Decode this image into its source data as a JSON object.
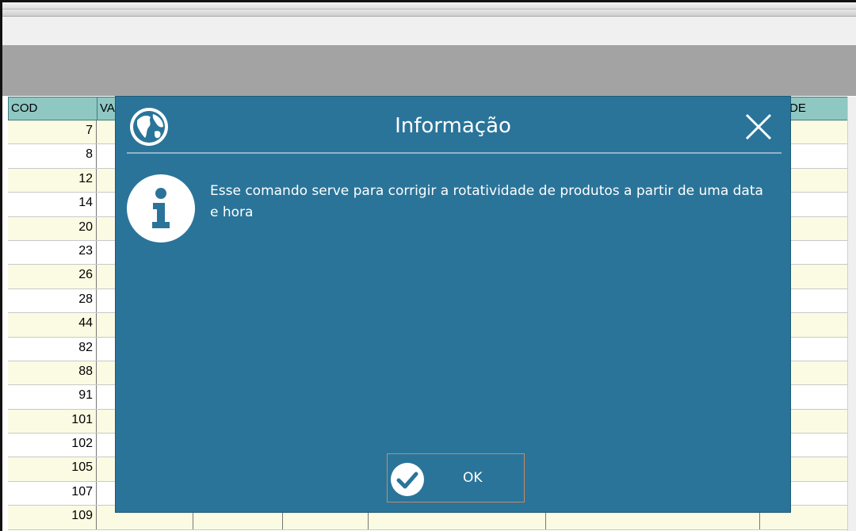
{
  "grid": {
    "columns": [
      "COD",
      "VA",
      "DE"
    ],
    "cod_values": [
      "7",
      "8",
      "12",
      "14",
      "20",
      "23",
      "26",
      "28",
      "44",
      "82",
      "88",
      "91",
      "101",
      "102",
      "105",
      "107",
      "109"
    ]
  },
  "dialog": {
    "title": "Informação",
    "message": "Esse comando serve para corrigir a rotatividade de produtos a partir de uma data e hora",
    "ok_label": "OK",
    "icons": [
      "globe-icon",
      "close-icon",
      "info-icon",
      "check-icon"
    ],
    "colors": {
      "background": "#2a7499",
      "text": "#ffffff"
    }
  }
}
